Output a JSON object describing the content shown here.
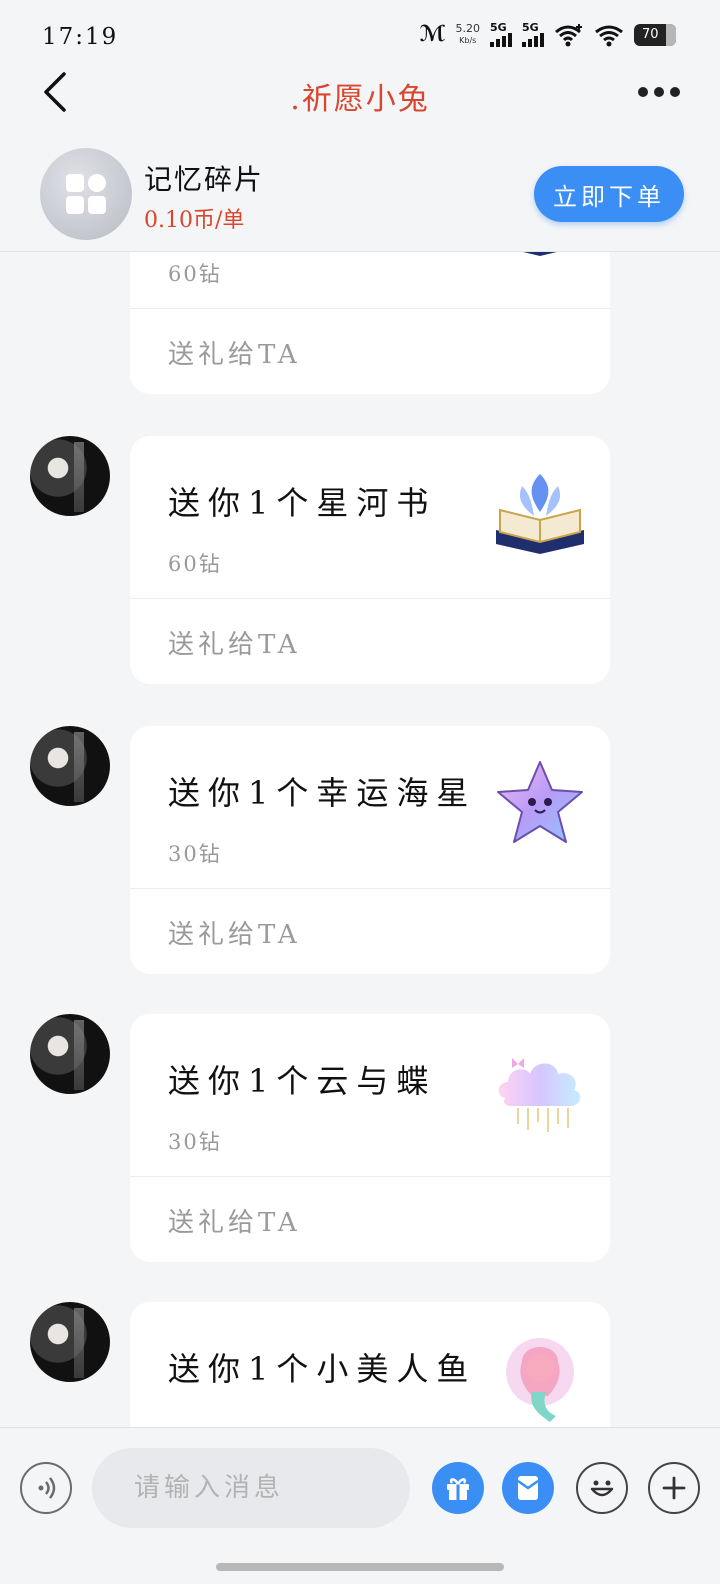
{
  "status_bar": {
    "time": "17:19",
    "net_speed": "5.20",
    "net_unit": "Kb/s",
    "sim1": "5G",
    "sim2": "5G",
    "battery": "70"
  },
  "nav": {
    "title": ".祈愿小兔",
    "back_icon": "chevron-left-icon",
    "more_icon": "more-dots-icon"
  },
  "service": {
    "name": "记忆碎片",
    "price": "0.10币/单",
    "order_label": "立即下单"
  },
  "messages": [
    {
      "title": "",
      "price": "60钻",
      "send_label": "送礼给TA",
      "gift_icon": "star-book-icon"
    },
    {
      "title": "送你1个星河书",
      "price": "60钻",
      "send_label": "送礼给TA",
      "gift_icon": "star-book-icon"
    },
    {
      "title": "送你1个幸运海星",
      "price": "30钻",
      "send_label": "送礼给TA",
      "gift_icon": "lucky-starfish-icon"
    },
    {
      "title": "送你1个云与蝶",
      "price": "30钻",
      "send_label": "送礼给TA",
      "gift_icon": "cloud-butterfly-icon"
    },
    {
      "title": "送你1个小美人鱼",
      "price": "",
      "send_label": "",
      "gift_icon": "mermaid-icon"
    }
  ],
  "input_bar": {
    "placeholder": "请输入消息",
    "voice_icon": "voice-icon",
    "gift_icon": "gift-icon",
    "red_packet_icon": "red-packet-icon",
    "emoji_icon": "emoji-icon",
    "plus_icon": "plus-icon"
  },
  "colors": {
    "accent": "#3b8ef3",
    "title_red": "#d9452e"
  }
}
